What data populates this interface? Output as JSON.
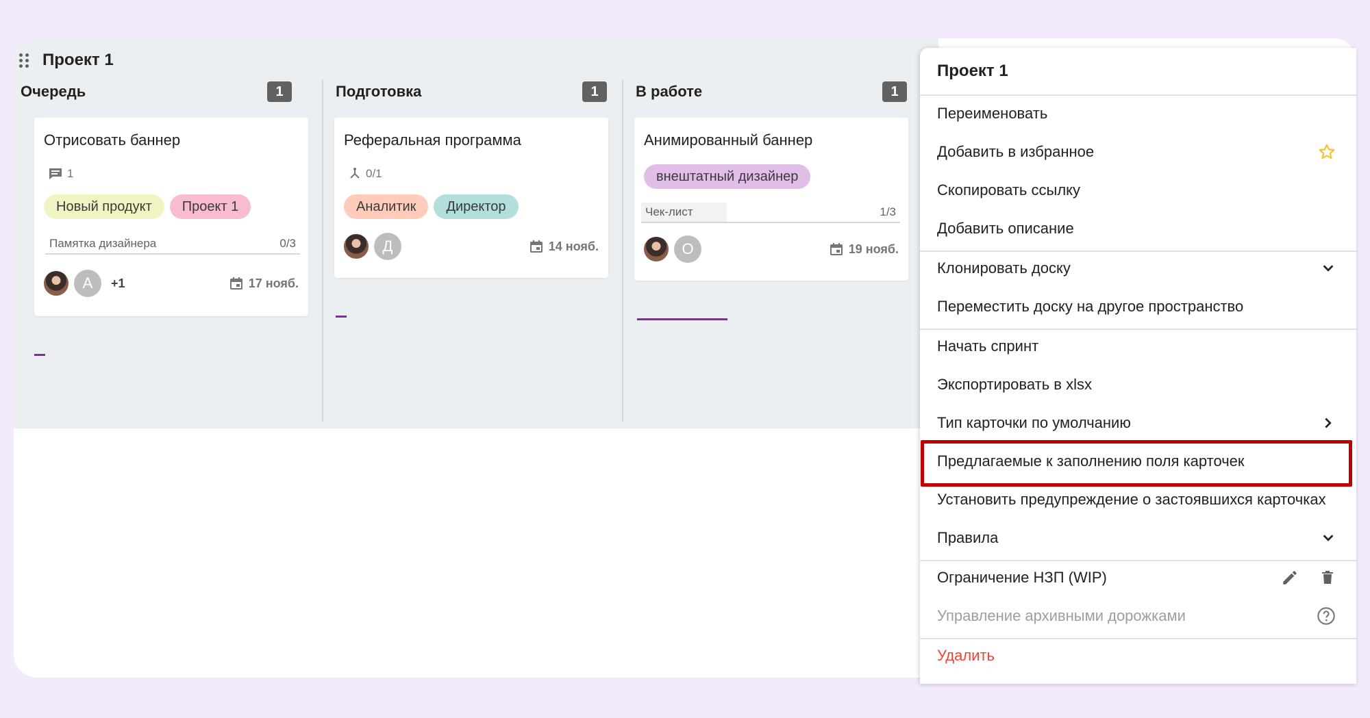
{
  "board": {
    "title": "Проект 1",
    "columns": [
      {
        "title": "Очередь",
        "count": "1",
        "card": {
          "title": "Отрисовать баннер",
          "meta_icon": "comment-icon",
          "meta_value": "1",
          "tags": [
            {
              "label": "Новый продукт",
              "color": "#f0f4c3"
            },
            {
              "label": "Проект 1",
              "color": "#f8bbd0"
            }
          ],
          "checklist": {
            "label": "Памятка дизайнера",
            "value": "0/3"
          },
          "avatars": [
            "photo",
            "А"
          ],
          "extra": "+1",
          "date": "17 нояб."
        }
      },
      {
        "title": "Подготовка",
        "count": "1",
        "card": {
          "title": "Реферальная программа",
          "meta_icon": "subtasks-icon",
          "meta_value": "0/1",
          "tags": [
            {
              "label": "Аналитик",
              "color": "#ffccbc"
            },
            {
              "label": "Директор",
              "color": "#b2dfdb"
            }
          ],
          "avatars": [
            "photo",
            "Д"
          ],
          "date": "14 нояб."
        }
      },
      {
        "title": "В работе",
        "count": "1",
        "card": {
          "title": "Анимированный баннер",
          "tags": [
            {
              "label": "внештатный дизайнер",
              "color": "#e1bee7"
            }
          ],
          "checklist": {
            "label": "Чек-лист",
            "value": "1/3",
            "progress": 0.33
          },
          "avatars": [
            "photo",
            "О"
          ],
          "date": "19 нояб."
        }
      }
    ]
  },
  "menu": {
    "title": "Проект 1",
    "items": {
      "rename": "Переименовать",
      "favorite": "Добавить в избранное",
      "copy_link": "Скопировать ссылку",
      "add_description": "Добавить описание",
      "clone": "Клонировать доску",
      "move": "Переместить доску на другое пространство",
      "sprint": "Начать спринт",
      "export": "Экспортировать в xlsx",
      "card_type": "Тип карточки по умолчанию",
      "suggested_fields": "Предлагаемые к заполнению поля карточек",
      "stale_warning": "Установить предупреждение о застоявшихся карточках",
      "rules": "Правила",
      "wip_limit": "Ограничение НЗП (WIP)",
      "archive_lanes": "Управление архивными дорожками",
      "delete": "Удалить"
    },
    "highlight_color": "#c00000",
    "danger_color": "#f44336",
    "star_color": "#fbc02d"
  }
}
